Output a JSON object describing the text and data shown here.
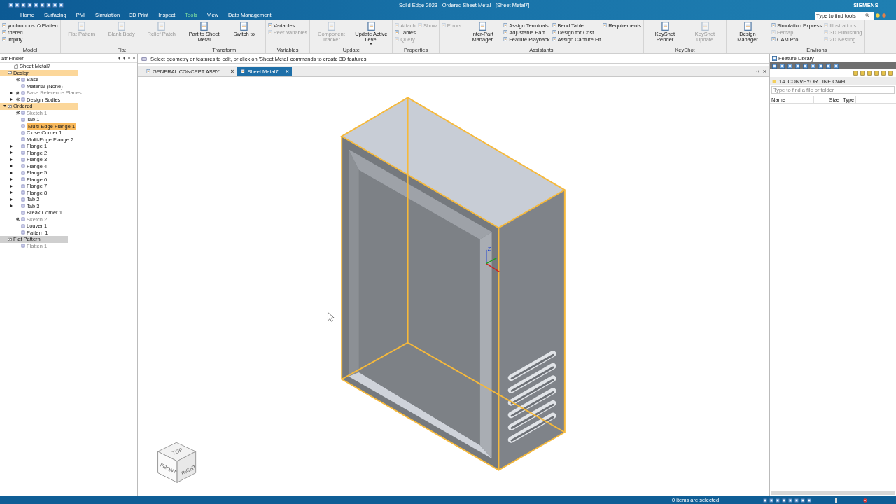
{
  "title_bar": {
    "title": "Solid Edge 2023 - Ordered Sheet Metal - [Sheet Metal7]",
    "brand": "SIEMENS",
    "minimize": "–",
    "search": {
      "placeholder": "Type to find tools"
    }
  },
  "menu_tabs": [
    {
      "label": "Home",
      "selected": false
    },
    {
      "label": "Surfacing",
      "selected": false
    },
    {
      "label": "PMI",
      "selected": false
    },
    {
      "label": "Simulation",
      "selected": false
    },
    {
      "label": "3D Print",
      "selected": false
    },
    {
      "label": "Inspect",
      "selected": false
    },
    {
      "label": "Tools",
      "selected": true
    },
    {
      "label": "View",
      "selected": false
    },
    {
      "label": "Data Management",
      "selected": false
    }
  ],
  "ribbon": [
    {
      "label": "Model",
      "items": [
        {
          "label": "ynchronous",
          "kind": "small",
          "disabled": false
        },
        {
          "label": "rdered",
          "kind": "small",
          "disabled": false
        },
        {
          "label": "implify",
          "kind": "small",
          "disabled": false
        },
        {
          "label": "Flatten",
          "kind": "radio",
          "selected": false,
          "disabled": false
        }
      ]
    },
    {
      "label": "Flat",
      "items": [
        {
          "label": "Flat Pattern",
          "kind": "large",
          "disabled": true
        },
        {
          "label": "Blank Body",
          "kind": "large",
          "disabled": true
        },
        {
          "label": "Relief Patch",
          "kind": "large",
          "disabled": true
        }
      ]
    },
    {
      "label": "Transform",
      "items": [
        {
          "label": "Part to Sheet Metal",
          "kind": "large",
          "disabled": false
        },
        {
          "label": "Switch to",
          "kind": "large",
          "disabled": false
        }
      ]
    },
    {
      "label": "Variables",
      "items": [
        {
          "label": "Variables",
          "kind": "small",
          "disabled": false
        },
        {
          "label": "Peer Variables",
          "kind": "small",
          "disabled": true
        }
      ]
    },
    {
      "label": "Update",
      "items": [
        {
          "label": "Component Tracker",
          "kind": "large",
          "disabled": true
        },
        {
          "label": "Update Active Level",
          "kind": "large",
          "disabled": false,
          "dropdown": true
        }
      ]
    },
    {
      "label": "Properties",
      "items": [
        {
          "label": "Attach",
          "kind": "small",
          "disabled": true
        },
        {
          "label": "Tables",
          "kind": "small",
          "disabled": false
        },
        {
          "label": "Query",
          "kind": "small",
          "disabled": true
        },
        {
          "label": "Show",
          "kind": "small",
          "disabled": true
        }
      ]
    },
    {
      "label": "Assistants",
      "items": [
        {
          "label": "Errors",
          "kind": "small",
          "disabled": true
        },
        {
          "label": "Inter-Part Manager",
          "kind": "large",
          "disabled": false
        },
        {
          "label": "Assign Terminals",
          "kind": "small",
          "disabled": false
        },
        {
          "label": "Adjustable Part",
          "kind": "small",
          "disabled": false
        },
        {
          "label": "Feature Playback",
          "kind": "small",
          "disabled": false
        },
        {
          "label": "Bend Table",
          "kind": "small",
          "disabled": false
        },
        {
          "label": "Design for Cost",
          "kind": "small",
          "disabled": false
        },
        {
          "label": "Assign Capture Fit",
          "kind": "small",
          "disabled": false
        },
        {
          "label": "Requirements",
          "kind": "small",
          "disabled": false
        }
      ]
    },
    {
      "label": "KeyShot",
      "items": [
        {
          "label": "KeyShot Render",
          "kind": "large",
          "disabled": false
        },
        {
          "label": "KeyShot Update",
          "kind": "large",
          "disabled": true
        }
      ]
    },
    {
      "items": [
        {
          "label": "Design Manager",
          "kind": "large",
          "disabled": false
        }
      ]
    },
    {
      "label": "Environs",
      "items": [
        {
          "label": "Simulation Express",
          "kind": "small",
          "disabled": false
        },
        {
          "label": "Femap",
          "kind": "small",
          "disabled": true
        },
        {
          "label": "CAM Pro",
          "kind": "small",
          "disabled": false
        },
        {
          "label": "Illustrations",
          "kind": "small",
          "disabled": true
        },
        {
          "label": "3D Publishing",
          "kind": "small",
          "disabled": true
        },
        {
          "label": "2D Nesting",
          "kind": "small",
          "disabled": true
        }
      ]
    }
  ],
  "pathfinder": {
    "title": "athFinder",
    "tree": [
      {
        "label": "Sheet Metal7",
        "kind": "part"
      },
      {
        "label": "Design",
        "kind": "section",
        "active": true,
        "children": [
          {
            "label": "Base",
            "kind": "feature",
            "visible": true
          },
          {
            "label": "Material (None)",
            "kind": "feature"
          },
          {
            "label": "Base Reference Planes",
            "kind": "feature",
            "dimmed": true,
            "visible": false,
            "expanded": false
          },
          {
            "label": "Design Bodies",
            "kind": "feature",
            "visible": true,
            "expanded": false
          }
        ]
      },
      {
        "label": "Ordered",
        "kind": "section",
        "active": true,
        "expanded": true,
        "children": [
          {
            "label": "Sketch 1",
            "kind": "feature",
            "dimmed": true,
            "visible": false
          },
          {
            "label": "Tab 1",
            "kind": "feature"
          },
          {
            "label": "Multi-Edge Flange 1",
            "kind": "feature",
            "selected": true
          },
          {
            "label": "Close Corner 1",
            "kind": "feature"
          },
          {
            "label": "Multi-Edge Flange 2",
            "kind": "feature"
          },
          {
            "label": "Flange 1",
            "kind": "feature",
            "expanded": false
          },
          {
            "label": "Flange 2",
            "kind": "feature",
            "expanded": false
          },
          {
            "label": "Flange 3",
            "kind": "feature",
            "expanded": false
          },
          {
            "label": "Flange 4",
            "kind": "feature",
            "expanded": false
          },
          {
            "label": "Flange 5",
            "kind": "feature",
            "expanded": false
          },
          {
            "label": "Flange 6",
            "kind": "feature",
            "expanded": false
          },
          {
            "label": "Flange 7",
            "kind": "feature",
            "expanded": false
          },
          {
            "label": "Flange 8",
            "kind": "feature",
            "expanded": false
          },
          {
            "label": "Tab 2",
            "kind": "feature",
            "expanded": false
          },
          {
            "label": "Tab 3",
            "kind": "feature",
            "expanded": false
          },
          {
            "label": "Break Corner 1",
            "kind": "feature"
          },
          {
            "label": "Sketch 2",
            "kind": "feature",
            "dimmed": true,
            "visible": false
          },
          {
            "label": "Louver 1",
            "kind": "feature"
          },
          {
            "label": "Pattern 1",
            "kind": "feature"
          }
        ]
      },
      {
        "label": "Flat Pattern",
        "kind": "section",
        "active": false,
        "children": [
          {
            "label": "Flatten 1",
            "kind": "feature",
            "dimmed": true
          }
        ]
      }
    ]
  },
  "prompt": "Select geometry or features to edit, or click on 'Sheet Metal' commands to create 3D features.",
  "doc_tabs": [
    {
      "label": "GENERAL CONCEPT ASSY...",
      "selected": false,
      "close": "×"
    },
    {
      "label": "Sheet Metal7",
      "selected": true,
      "close": "×"
    }
  ],
  "viewport": {
    "triad_label": "Z",
    "view_cube": [
      "TOP",
      "FRONT",
      "RIGHT"
    ]
  },
  "feature_library": {
    "title": "Feature Library",
    "folder": "14. CONVEYOR LINE CWH",
    "search": {
      "placeholder": "Type to find a file or folder"
    },
    "columns": [
      "Name",
      "Size",
      "Type"
    ]
  },
  "status_bar": {
    "text": "0 items are selected",
    "zoom": {
      "level": 0.45
    }
  }
}
